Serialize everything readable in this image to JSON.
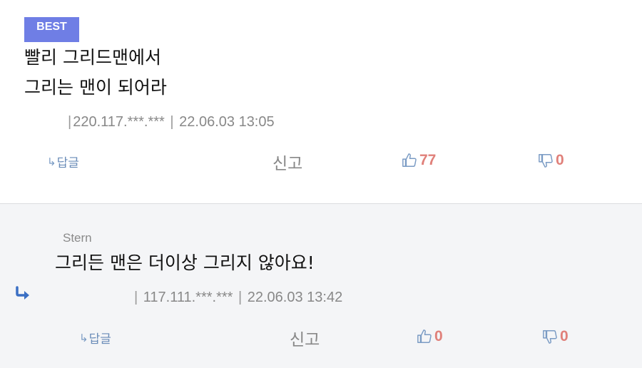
{
  "comments": [
    {
      "badge": "BEST",
      "lines": [
        "빨리 그리드맨에서",
        "그리는 맨이 되어라"
      ],
      "ip": "220.117.***.***",
      "date": "22.06.03 13:05",
      "reply_label": "답글",
      "report_label": "신고",
      "likes": "77",
      "dislikes": "0"
    },
    {
      "author": "Stern",
      "lines": [
        "그리든 맨은 더이상 그리지 않아요!"
      ],
      "ip": "117.111.***.***",
      "date": "22.06.03 13:42",
      "reply_label": "답글",
      "report_label": "신고",
      "likes": "0",
      "dislikes": "0"
    }
  ],
  "icons": {
    "reply_arrow": "reply-arrow-icon",
    "thumbs_up": "thumbs-up-icon",
    "thumbs_down": "thumbs-down-icon",
    "reply_indicator": "reply-indicator-icon"
  },
  "colors": {
    "badge": "#6f7ee5",
    "vote_count": "#e0807a",
    "reply_link": "#6a8cb8",
    "icon_blue": "#7a9bc4",
    "reply_bg": "#f4f5f7"
  }
}
